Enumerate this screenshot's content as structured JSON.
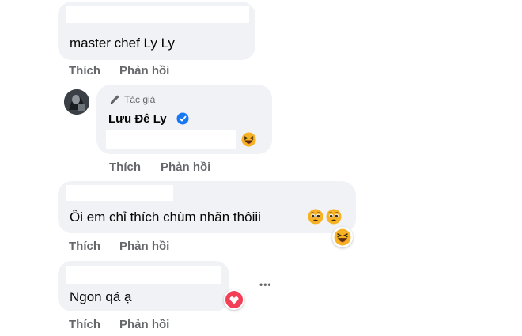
{
  "comments": [
    {
      "text": "master chef Ly Ly",
      "like_label": "Thích",
      "reply_label": "Phản hồi"
    },
    {
      "author_tag": "Tác giả",
      "author_name": "Lưu Đê Ly",
      "like_label": "Thích",
      "reply_label": "Phản hồi"
    },
    {
      "text": "Ôi em chỉ thích chùm nhãn thôiii",
      "like_label": "Thích",
      "reply_label": "Phản hồi"
    },
    {
      "text": "Ngon qá ạ",
      "like_label": "Thích",
      "reply_label": "Phản hồi",
      "more_label": "•••"
    }
  ],
  "icons": {
    "pencil": "pencil-icon",
    "verified": "verified-badge-icon",
    "laugh": "laughing-emoji-icon",
    "sad": "pleading-face-emoji-icon",
    "love": "love-reaction-icon"
  },
  "colors": {
    "bubble": "#f0f2f5",
    "action_text": "#65676b",
    "verified": "#1877f2",
    "love": "#f33e58",
    "emoji_yellow": "#f7b125"
  }
}
